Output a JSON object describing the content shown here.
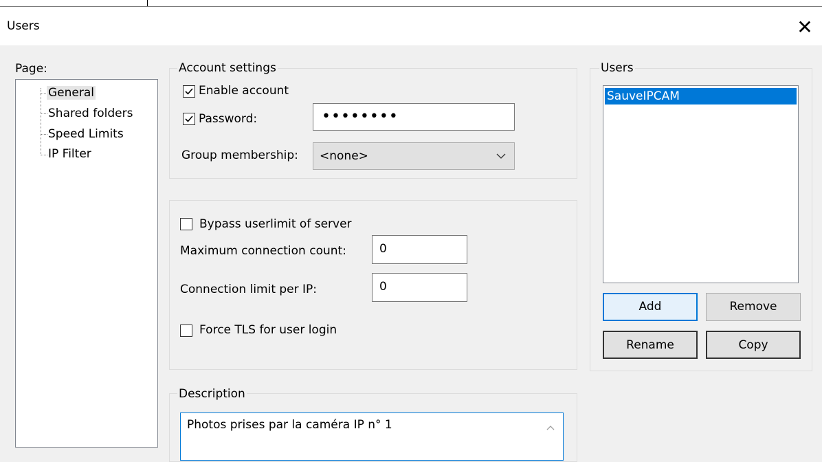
{
  "window": {
    "title": "Users",
    "close_glyph": "✕"
  },
  "page_panel": {
    "label": "Page:",
    "items": [
      "General",
      "Shared folders",
      "Speed Limits",
      "IP Filter"
    ]
  },
  "account_settings": {
    "legend": "Account settings",
    "enable_account": {
      "label": "Enable account",
      "checked": true
    },
    "password": {
      "label": "Password:",
      "checked": true,
      "value": "••••••••"
    },
    "group_membership": {
      "label": "Group membership:",
      "value": "<none>"
    }
  },
  "limits": {
    "bypass": {
      "label": "Bypass userlimit of server",
      "checked": false
    },
    "max_conn": {
      "label": "Maximum connection count:",
      "value": "0"
    },
    "conn_per_ip": {
      "label": "Connection limit per IP:",
      "value": "0"
    },
    "force_tls": {
      "label": "Force TLS for user login",
      "checked": false
    }
  },
  "description": {
    "legend": "Description",
    "value": "Photos prises par la caméra IP n° 1"
  },
  "users_panel": {
    "legend": "Users",
    "items": [
      "SauveIPCAM"
    ],
    "buttons": {
      "add": "Add",
      "remove": "Remove",
      "rename": "Rename",
      "copy": "Copy"
    }
  },
  "colors": {
    "selection": "#0078d7",
    "accent": "#0078d7"
  }
}
